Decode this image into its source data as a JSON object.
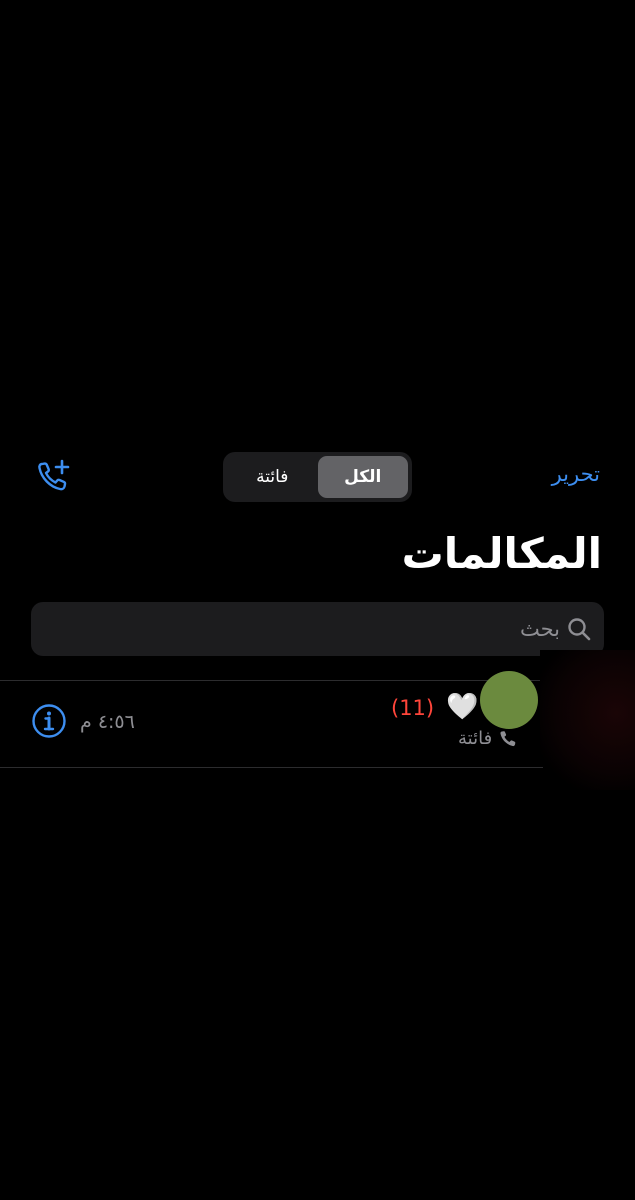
{
  "header": {
    "edit_label": "تحرير",
    "add_call_icon": "phone-plus-icon",
    "segments": [
      {
        "label": "الكل",
        "selected": true
      },
      {
        "label": "فائتة",
        "selected": false
      }
    ]
  },
  "title": "المكالمات",
  "search": {
    "placeholder": "بحث",
    "value": "",
    "icon": "search-icon"
  },
  "calls": [
    {
      "name": "🤍",
      "count": "(11)",
      "type_label": "فائتة",
      "type_icon": "phone-icon",
      "time": "٤:٥٦ م",
      "avatar_color": "#6b8a3e"
    }
  ],
  "colors": {
    "accent": "#3d8ef0",
    "missed": "#ff453a",
    "background": "#000000",
    "control_bg": "#1c1c1e",
    "secondary_text": "#8e8e93"
  }
}
